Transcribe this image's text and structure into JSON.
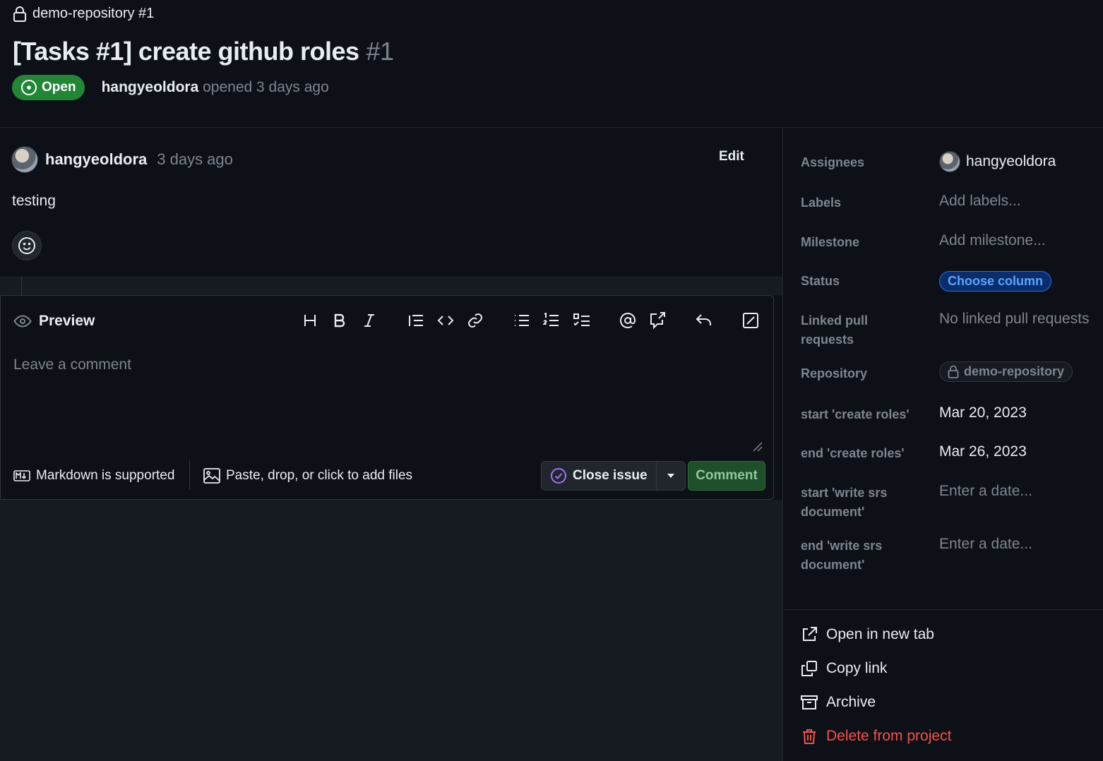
{
  "header": {
    "repo_ref": "demo-repository #1",
    "title": "[Tasks #1] create github roles",
    "number": "#1",
    "state": "Open",
    "author": "hangyeoldora",
    "opened_text": "opened 3 days ago"
  },
  "comment": {
    "author": "hangyeoldora",
    "time": "3 days ago",
    "edit_label": "Edit",
    "body": "testing"
  },
  "editor": {
    "preview_label": "Preview",
    "placeholder": "Leave a comment",
    "markdown_note": "Markdown is supported",
    "files_note": "Paste, drop, or click to add files",
    "close_label": "Close issue",
    "comment_label": "Comment"
  },
  "sidebar": {
    "fields": [
      {
        "label": "Assignees",
        "value": "hangyeoldora"
      },
      {
        "label": "Labels",
        "value": "Add labels..."
      },
      {
        "label": "Milestone",
        "value": "Add milestone..."
      },
      {
        "label": "Status",
        "value": "Choose column"
      },
      {
        "label": "Linked pull requests",
        "value": "No linked pull requests"
      },
      {
        "label": "Repository",
        "value": "demo-repository"
      },
      {
        "label": "start 'create roles'",
        "value": "Mar 20, 2023"
      },
      {
        "label": "end 'create roles'",
        "value": "Mar 26, 2023"
      },
      {
        "label": "start 'write srs document'",
        "value": "Enter a date..."
      },
      {
        "label": "end 'write srs document'",
        "value": "Enter a date..."
      }
    ],
    "actions": {
      "open_tab": "Open in new tab",
      "copy_link": "Copy link",
      "archive": "Archive",
      "delete": "Delete from project"
    }
  },
  "colors": {
    "background": "#0d1117",
    "open_green": "#238636",
    "accent_blue": "#58a6ff",
    "danger_red": "#f85149",
    "muted": "#7d8590"
  }
}
